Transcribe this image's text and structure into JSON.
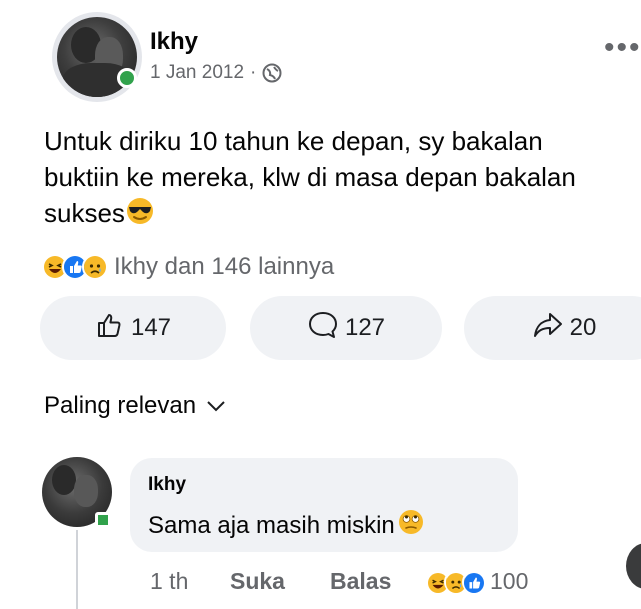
{
  "post": {
    "author": "Ikhy",
    "date": "1 Jan 2012",
    "separator": "·",
    "text": "Untuk diriku 10 tahun ke depan, sy bakalan buktiin ke mereka, klw di masa depan bakalan sukses",
    "text_emoji": "sunglasses-face",
    "reactions": {
      "icons": [
        "haha-icon",
        "like-icon",
        "sad-icon"
      ],
      "summary": "Ikhy dan 146 lainnya"
    },
    "actions": {
      "like_count": "147",
      "comment_count": "127",
      "share_count": "20"
    }
  },
  "sort": {
    "label": "Paling relevan"
  },
  "comment": {
    "author": "Ikhy",
    "text": "Sama aja masih miskin",
    "text_emoji": "rolling-eyes-face",
    "time": "1 th",
    "like_label": "Suka",
    "reply_label": "Balas",
    "reactions": [
      "haha-icon",
      "sad-icon",
      "like-icon"
    ],
    "reaction_count": "100"
  },
  "colors": {
    "online": "#31a24c",
    "like_blue": "#1877f2",
    "emoji_yellow": "#f7b928",
    "muted_text": "#65676b",
    "button_bg": "#f0f2f5"
  }
}
